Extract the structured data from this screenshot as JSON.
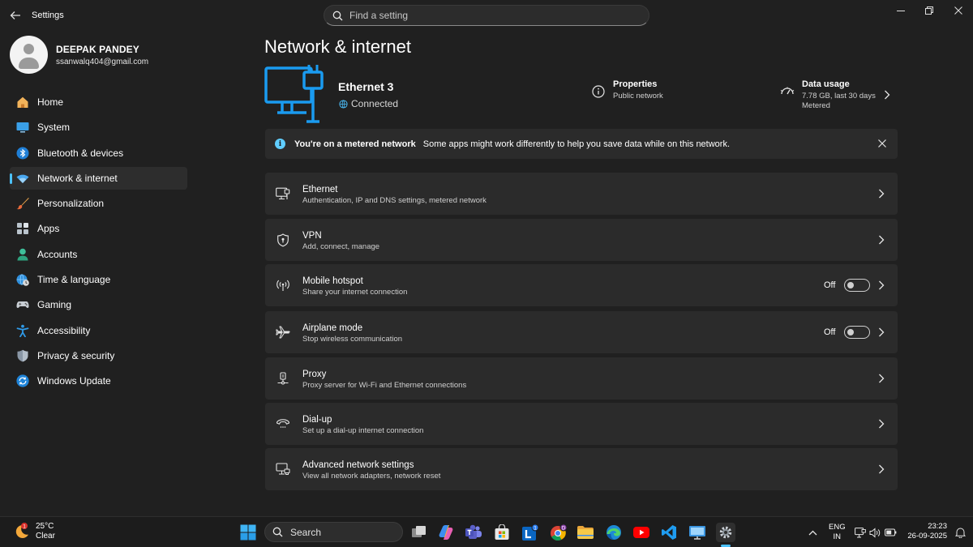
{
  "window": {
    "title": "Settings",
    "search_placeholder": "Find a setting"
  },
  "profile": {
    "name": "DEEPAK PANDEY",
    "email": "ssanwalq404@gmail.com"
  },
  "nav": [
    {
      "label": "Home",
      "icon": "home-icon"
    },
    {
      "label": "System",
      "icon": "monitor-icon"
    },
    {
      "label": "Bluetooth & devices",
      "icon": "bluetooth-icon"
    },
    {
      "label": "Network & internet",
      "icon": "wifi-icon",
      "active": true
    },
    {
      "label": "Personalization",
      "icon": "paintbrush-icon"
    },
    {
      "label": "Apps",
      "icon": "apps-icon"
    },
    {
      "label": "Accounts",
      "icon": "person-icon"
    },
    {
      "label": "Time & language",
      "icon": "globe-clock-icon"
    },
    {
      "label": "Gaming",
      "icon": "gamepad-icon"
    },
    {
      "label": "Accessibility",
      "icon": "accessibility-icon"
    },
    {
      "label": "Privacy & security",
      "icon": "shield-icon"
    },
    {
      "label": "Windows Update",
      "icon": "update-icon"
    }
  ],
  "main": {
    "title": "Network & internet",
    "connection": {
      "name": "Ethernet 3",
      "status": "Connected",
      "properties_title": "Properties",
      "properties_sub": "Public network",
      "usage_title": "Data usage",
      "usage_sub1": "7.78 GB, last 30 days",
      "usage_sub2": "Metered"
    },
    "banner": {
      "title": "You're on a metered network",
      "message": "Some apps might work differently to help you save data while on this network."
    },
    "cards": [
      {
        "title": "Ethernet",
        "sub": "Authentication, IP and DNS settings, metered network",
        "icon": "ethernet-icon"
      },
      {
        "title": "VPN",
        "sub": "Add, connect, manage",
        "icon": "vpn-shield-icon"
      },
      {
        "title": "Mobile hotspot",
        "sub": "Share your internet connection",
        "icon": "hotspot-icon",
        "toggle": "Off"
      },
      {
        "title": "Airplane mode",
        "sub": "Stop wireless communication",
        "icon": "airplane-icon",
        "toggle": "Off"
      },
      {
        "title": "Proxy",
        "sub": "Proxy server for Wi-Fi and Ethernet connections",
        "icon": "proxy-icon"
      },
      {
        "title": "Dial-up",
        "sub": "Set up a dial-up internet connection",
        "icon": "dialup-icon"
      },
      {
        "title": "Advanced network settings",
        "sub": "View all network adapters, network reset",
        "icon": "advanced-network-icon"
      }
    ]
  },
  "taskbar": {
    "weather_temp": "25°C",
    "weather_cond": "Clear",
    "weather_badge": "1",
    "search_label": "Search",
    "lang1": "ENG",
    "lang2": "IN",
    "time": "23:23",
    "date": "26-09-2025",
    "app_badges": {
      "linkedin": "1",
      "chrome": "D"
    }
  },
  "colors": {
    "accent": "#4cc2ff",
    "icon_blue": "#1a9bf0",
    "background": "#202020",
    "card": "#2b2b2b"
  }
}
